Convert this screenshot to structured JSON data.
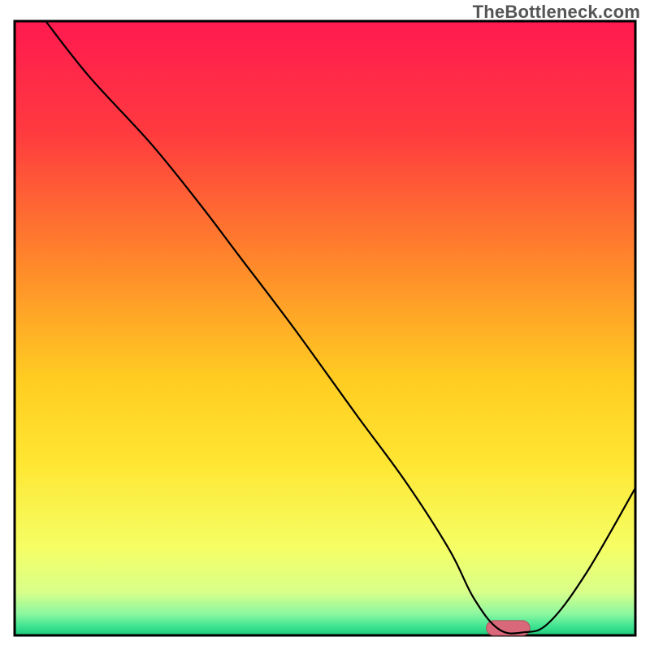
{
  "watermark": "TheBottleneck.com",
  "chart_data": {
    "type": "line",
    "title": "",
    "xlabel": "",
    "ylabel": "",
    "xlim": [
      0,
      100
    ],
    "ylim": [
      0,
      100
    ],
    "grid": false,
    "legend": false,
    "background_gradient_stops": [
      {
        "offset": 0.0,
        "color": "#ff1a50"
      },
      {
        "offset": 0.18,
        "color": "#ff3a3f"
      },
      {
        "offset": 0.4,
        "color": "#ff8a2a"
      },
      {
        "offset": 0.58,
        "color": "#ffcc22"
      },
      {
        "offset": 0.72,
        "color": "#ffe633"
      },
      {
        "offset": 0.86,
        "color": "#f5ff66"
      },
      {
        "offset": 0.93,
        "color": "#d8ff8a"
      },
      {
        "offset": 0.965,
        "color": "#8cf7a0"
      },
      {
        "offset": 0.985,
        "color": "#3fe492"
      },
      {
        "offset": 1.0,
        "color": "#1cc97a"
      }
    ],
    "series": [
      {
        "name": "bottleneck-curve",
        "stroke": "#000000",
        "stroke_width": 2.2,
        "x": [
          5,
          12,
          22,
          30,
          36,
          45,
          55,
          63,
          70,
          74,
          78,
          82,
          86,
          92,
          100
        ],
        "y": [
          100,
          91,
          80,
          70,
          62,
          50,
          36,
          25,
          14,
          6,
          1,
          0.5,
          2,
          10,
          24
        ]
      }
    ],
    "markers": [
      {
        "name": "target-marker",
        "shape": "capsule",
        "x_center": 79.5,
        "y_center": 1.2,
        "width_x": 7.0,
        "height_y": 2.4,
        "fill": "#d9697a",
        "stroke": "#b34e5e"
      }
    ],
    "frame": {
      "stroke": "#000000",
      "width": 3
    }
  }
}
